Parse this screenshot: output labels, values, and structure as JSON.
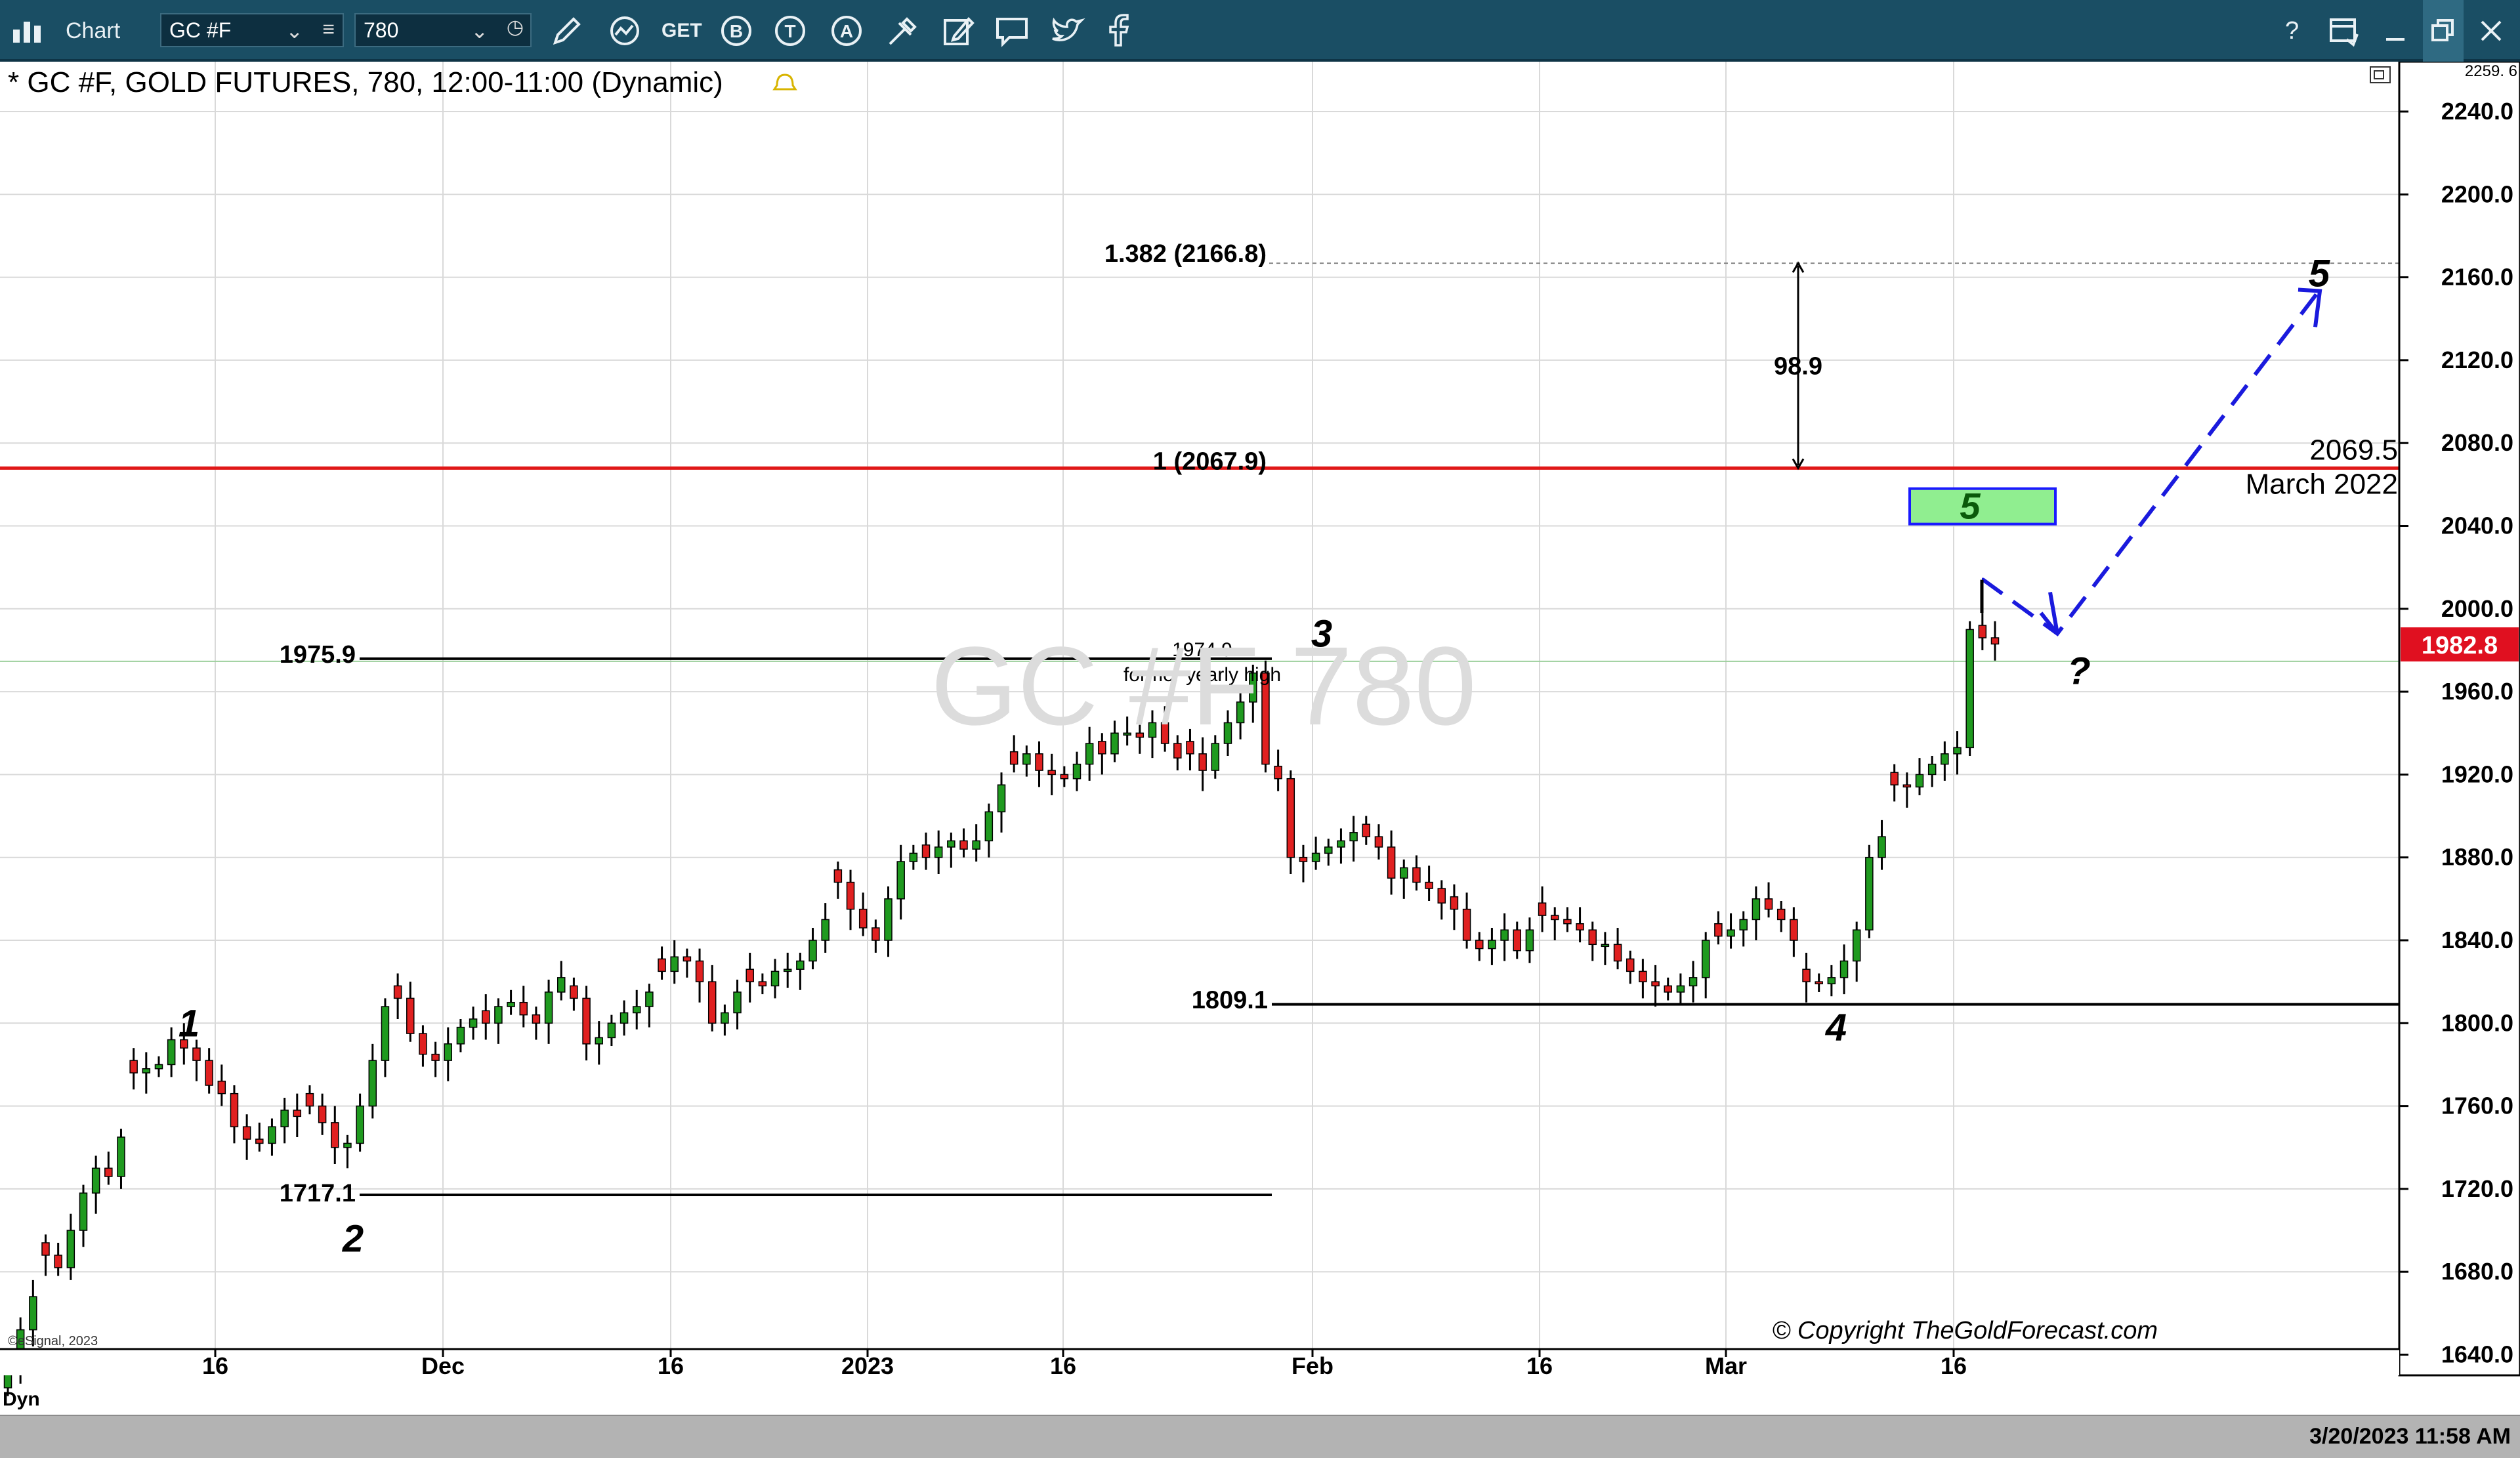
{
  "toolbar": {
    "app_title": "Chart",
    "symbol_value": "GC #F",
    "interval_value": "780",
    "icons": [
      "chart-app-icon",
      "symbol-dropdown-icon",
      "symbol-list-icon",
      "interval-dropdown-icon",
      "clock-icon",
      "draw-pencil-icon",
      "indicator-icon",
      "get-icon",
      "b-icon",
      "t-icon",
      "a-icon",
      "tools-icon",
      "edit-icon",
      "comment-icon",
      "twitter-icon",
      "facebook-icon",
      "help-icon",
      "save-icon",
      "minimize-icon",
      "restore-icon",
      "close-icon"
    ],
    "get_label": "GET",
    "b_label": "B",
    "t_label": "T",
    "a_label": "A",
    "help_label": "?"
  },
  "chart_header": {
    "title": "* GC #F, GOLD FUTURES, 780, 12:00-11:00 (Dynamic)",
    "watermark": "GC #F 780",
    "scale_top": "2259. 6",
    "copyright": "© Copyright TheGoldForecast.com",
    "esignal": "©eSignal, 2023"
  },
  "status_bar": {
    "timestamp": "3/20/2023 11:58 AM",
    "dyn_label": "Dyn"
  },
  "chart_data": {
    "type": "candlestick",
    "symbol": "GC #F",
    "description": "GOLD FUTURES",
    "interval": "780",
    "ylim": [
      1620,
      2265
    ],
    "y_ticks": [
      1640.0,
      1680.0,
      1720.0,
      1760.0,
      1800.0,
      1840.0,
      1880.0,
      1920.0,
      1960.0,
      2000.0,
      2040.0,
      2080.0,
      2120.0,
      2160.0,
      2200.0,
      2240.0
    ],
    "x_tick_labels": [
      "16",
      "Dec",
      "16",
      "2023",
      "16",
      "Feb",
      "16",
      "Mar",
      "16"
    ],
    "last_price": "1982.8",
    "grid": true,
    "series": [
      {
        "name": "price",
        "values": [
          1632,
          1652,
          1668,
          1688,
          1682,
          1700,
          1718,
          1730,
          1726,
          1745,
          1776,
          1778,
          1780,
          1792,
          1788,
          1782,
          1770,
          1766,
          1750,
          1744,
          1742,
          1750,
          1758,
          1755,
          1760,
          1752,
          1740,
          1742,
          1760,
          1782,
          1808,
          1812,
          1795,
          1785,
          1782,
          1790,
          1798,
          1802,
          1800,
          1808,
          1810,
          1804,
          1800,
          1815,
          1822,
          1812,
          1790,
          1793,
          1800,
          1805,
          1808,
          1815,
          1825,
          1832,
          1830,
          1820,
          1800,
          1805,
          1815,
          1820,
          1818,
          1825,
          1826,
          1830,
          1840,
          1850,
          1868,
          1855,
          1846,
          1840,
          1860,
          1878,
          1882,
          1880,
          1885,
          1888,
          1884,
          1888,
          1902,
          1915,
          1925,
          1930,
          1922,
          1920,
          1918,
          1925,
          1935,
          1930,
          1940,
          1940,
          1938,
          1945,
          1935,
          1928,
          1930,
          1922,
          1935,
          1945,
          1955,
          1969,
          1925,
          1918,
          1880,
          1878,
          1882,
          1885,
          1888,
          1892,
          1890,
          1885,
          1870,
          1875,
          1868,
          1865,
          1858,
          1855,
          1840,
          1836,
          1840,
          1845,
          1835,
          1845,
          1852,
          1850,
          1848,
          1845,
          1838,
          1838,
          1830,
          1825,
          1820,
          1818,
          1815,
          1818,
          1822,
          1840,
          1842,
          1845,
          1850,
          1860,
          1855,
          1850,
          1840,
          1820,
          1819,
          1822,
          1830,
          1845,
          1880,
          1890,
          1915,
          1914,
          1920,
          1925,
          1930,
          1933,
          1990,
          1986,
          1983
        ]
      }
    ],
    "annotations": [
      {
        "text": "1.382 (2166.8)",
        "price": 2166.8
      },
      {
        "text": "1 (2067.9)",
        "price": 2067.9
      },
      {
        "text": "2069.5",
        "price": 2069.5
      },
      {
        "text": "March 2022",
        "price": 2052
      },
      {
        "text": "98.9",
        "price": 2117
      },
      {
        "text": "1975.9",
        "price": 1975.9
      },
      {
        "text": "1974.9",
        "price": 1974.9
      },
      {
        "text": "former yearly high",
        "price": 1963
      },
      {
        "text": "1809.1",
        "price": 1809.1
      },
      {
        "text": "1717.1",
        "price": 1717.1
      }
    ],
    "wave_labels": [
      {
        "text": "1",
        "price": 1800
      },
      {
        "text": "2",
        "price": 1696
      },
      {
        "text": "3",
        "price": 1988
      },
      {
        "text": "4",
        "price": 1798
      },
      {
        "text": "5",
        "price": 2054
      },
      {
        "text": "?",
        "price": 1970
      },
      {
        "text": "5",
        "price": 2162
      }
    ]
  }
}
